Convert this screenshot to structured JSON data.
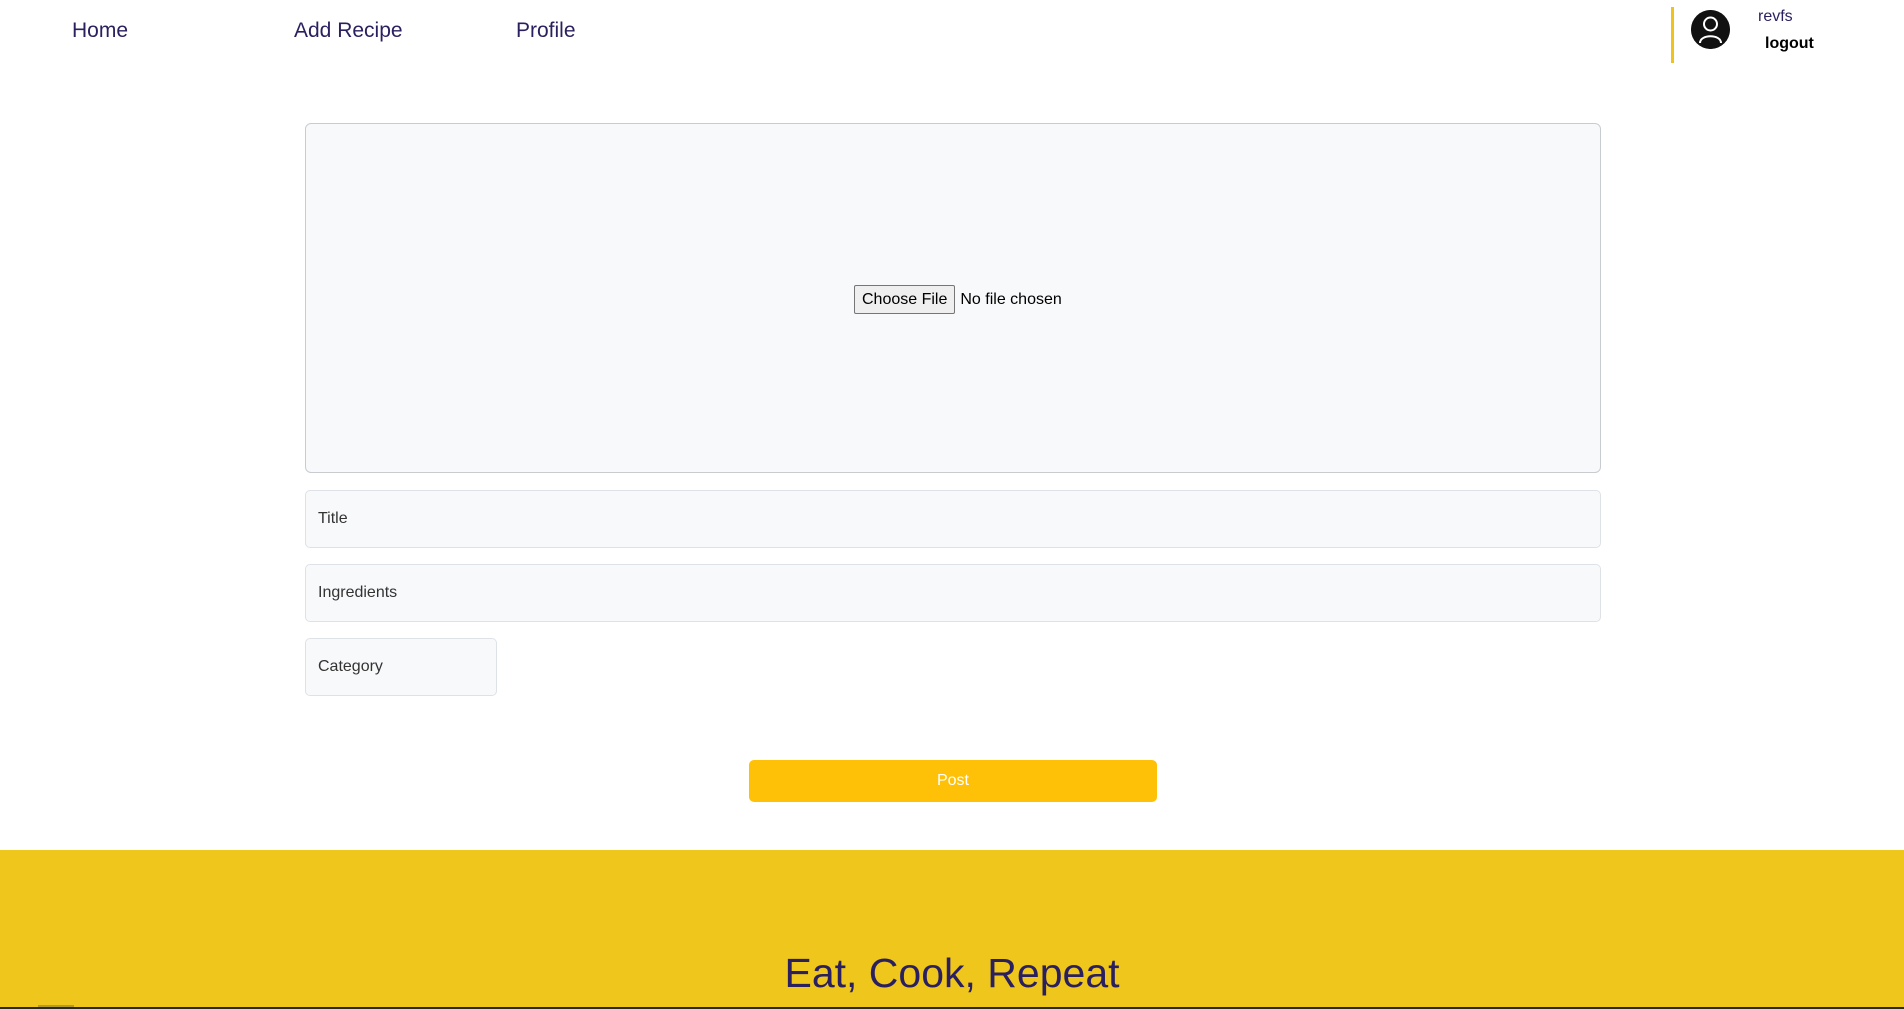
{
  "nav": {
    "home": "Home",
    "add_recipe": "Add Recipe",
    "profile": "Profile"
  },
  "user": {
    "name": "revfs",
    "logout": "logout"
  },
  "form": {
    "file_button": "Choose File",
    "file_status": "No file chosen",
    "title_placeholder": "Title",
    "ingredients_placeholder": "Ingredients",
    "category_placeholder": "Category",
    "post": "Post"
  },
  "footer": {
    "tagline": "Eat, Cook, Repeat"
  },
  "colors": {
    "accent": "#ffc107",
    "footer_bg": "#efc61b",
    "nav_text": "#2a1f5f"
  },
  "icons": {
    "avatar": "user-avatar-icon"
  }
}
